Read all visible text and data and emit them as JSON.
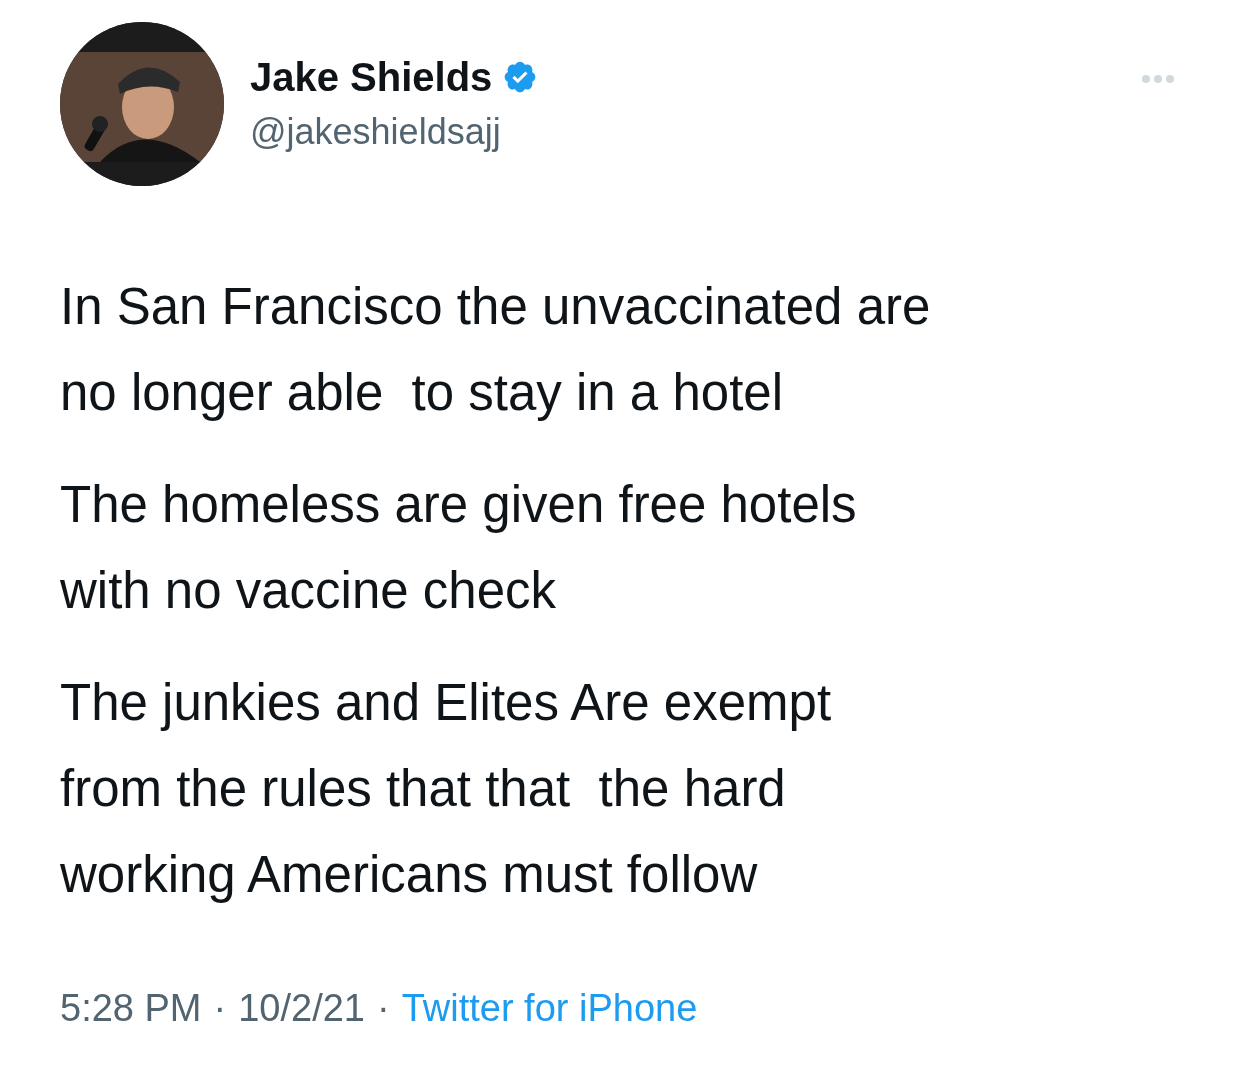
{
  "author": {
    "name": "Jake Shields",
    "verified": true,
    "handle": "@jakeshieldsajj"
  },
  "paragraphs": [
    [
      "In San Francisco the unvaccinated are",
      "no longer able  to stay in a hotel"
    ],
    [
      "The homeless are given free hotels",
      "with no vaccine check"
    ],
    [
      "The junkies and Elites Are exempt",
      "from the rules that that  the hard",
      "working Americans must follow"
    ]
  ],
  "meta": {
    "time": "5:28 PM",
    "separator_1": "·",
    "date": "10/2/21",
    "separator_2": "·",
    "source": "Twitter for iPhone"
  }
}
